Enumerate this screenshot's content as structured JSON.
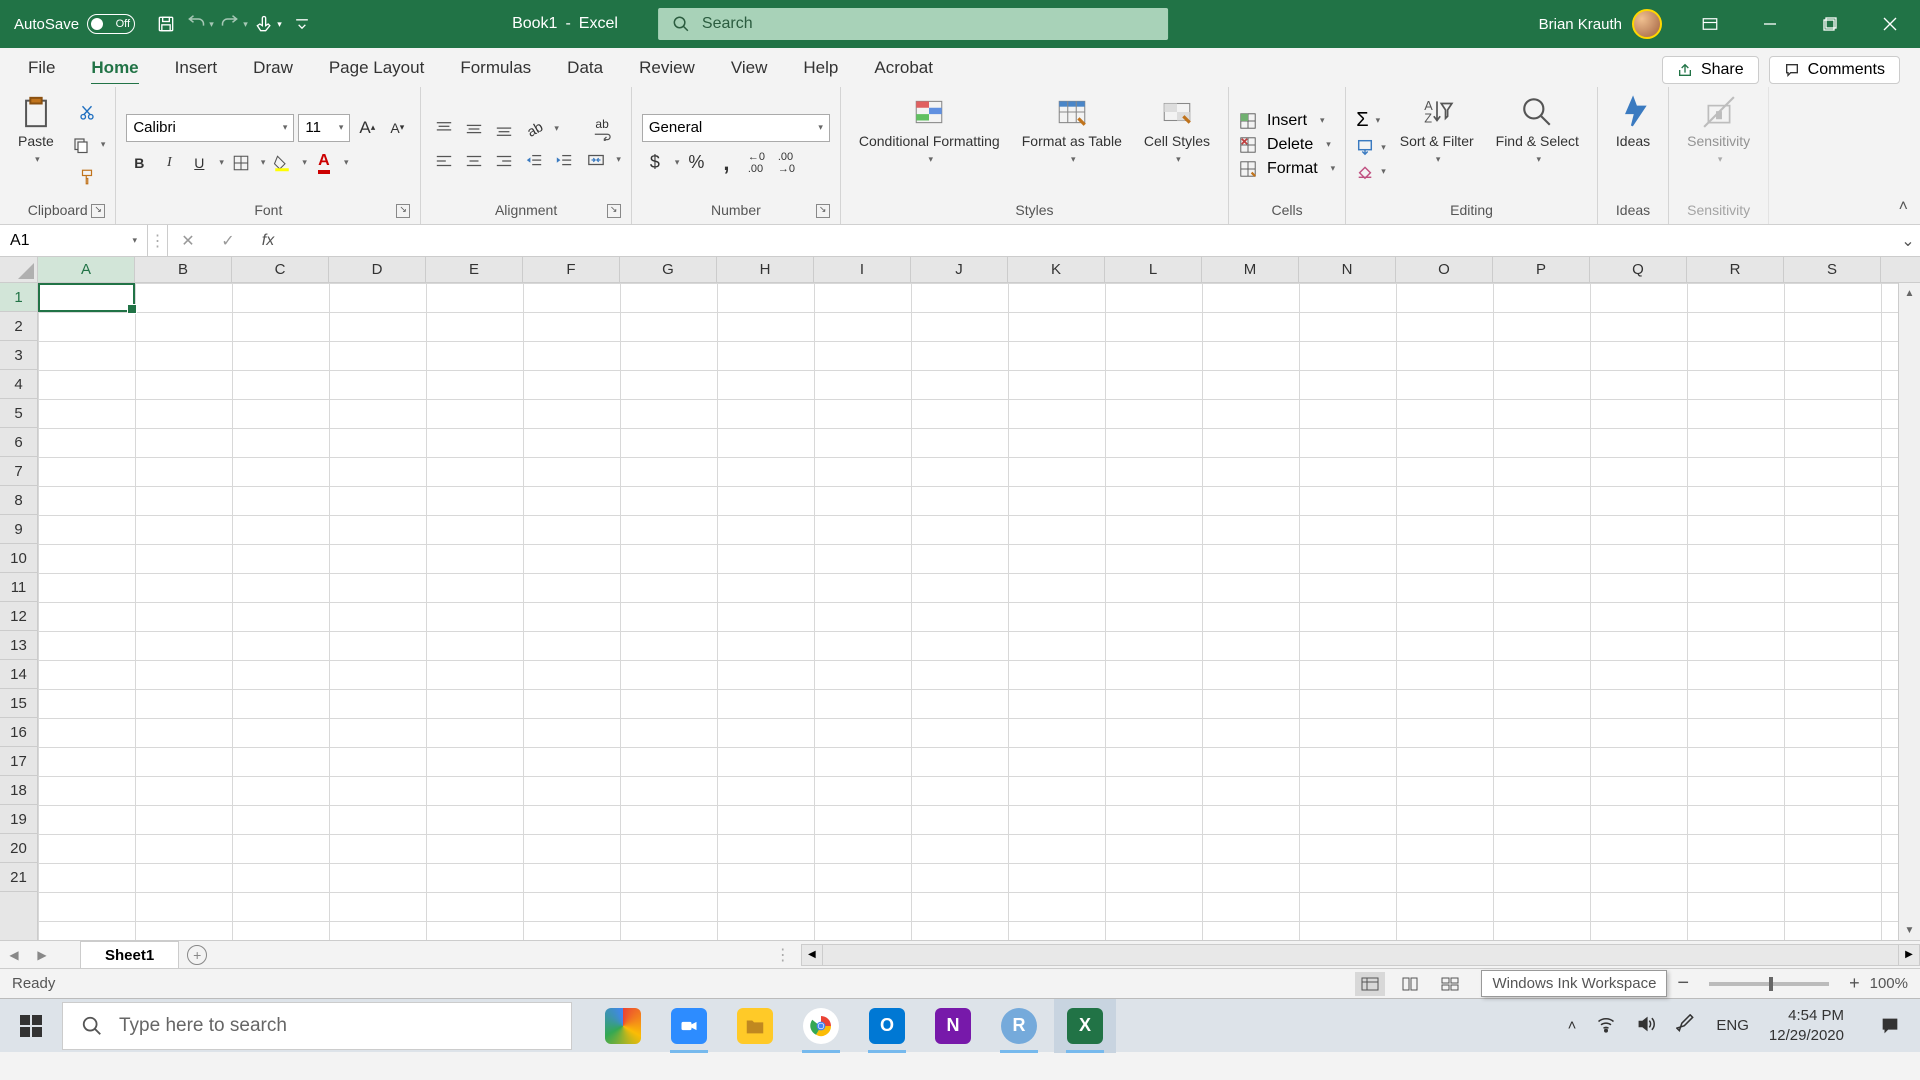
{
  "title_bar": {
    "autosave_label": "AutoSave",
    "autosave_state": "Off",
    "doc_name": "Book1",
    "app_name": "Excel",
    "search_placeholder": "Search",
    "user_name": "Brian Krauth"
  },
  "tabs": [
    "File",
    "Home",
    "Insert",
    "Draw",
    "Page Layout",
    "Formulas",
    "Data",
    "Review",
    "View",
    "Help",
    "Acrobat"
  ],
  "active_tab": "Home",
  "share_label": "Share",
  "comments_label": "Comments",
  "ribbon": {
    "clipboard": {
      "paste": "Paste",
      "label": "Clipboard"
    },
    "font": {
      "name": "Calibri",
      "size": "11",
      "label": "Font",
      "bold": "B",
      "italic": "I",
      "underline": "U"
    },
    "alignment": {
      "label": "Alignment",
      "wrap": "ab"
    },
    "number": {
      "format": "General",
      "label": "Number"
    },
    "styles": {
      "conditional": "Conditional Formatting",
      "table": "Format as Table",
      "cell": "Cell Styles",
      "label": "Styles"
    },
    "cells": {
      "insert": "Insert",
      "delete": "Delete",
      "format": "Format",
      "label": "Cells"
    },
    "editing": {
      "sort": "Sort & Filter",
      "find": "Find & Select",
      "label": "Editing"
    },
    "ideas": {
      "btn": "Ideas",
      "label": "Ideas"
    },
    "sensitivity": {
      "btn": "Sensitivity",
      "label": "Sensitivity"
    }
  },
  "name_box": "A1",
  "columns": [
    "A",
    "B",
    "C",
    "D",
    "E",
    "F",
    "G",
    "H",
    "I",
    "J",
    "K",
    "L",
    "M",
    "N",
    "O",
    "P",
    "Q",
    "R",
    "S"
  ],
  "active_column": "A",
  "rows": [
    1,
    2,
    3,
    4,
    5,
    6,
    7,
    8,
    9,
    10,
    11,
    12,
    13,
    14,
    15,
    16,
    17,
    18,
    19,
    20,
    21
  ],
  "active_row": 1,
  "sheet_tabs": [
    "Sheet1"
  ],
  "status": {
    "ready": "Ready",
    "zoom": "100%",
    "tooltip": "Windows Ink Workspace"
  },
  "taskbar": {
    "search_placeholder": "Type here to search",
    "lang": "ENG",
    "time": "4:54 PM",
    "date": "12/29/2020"
  }
}
